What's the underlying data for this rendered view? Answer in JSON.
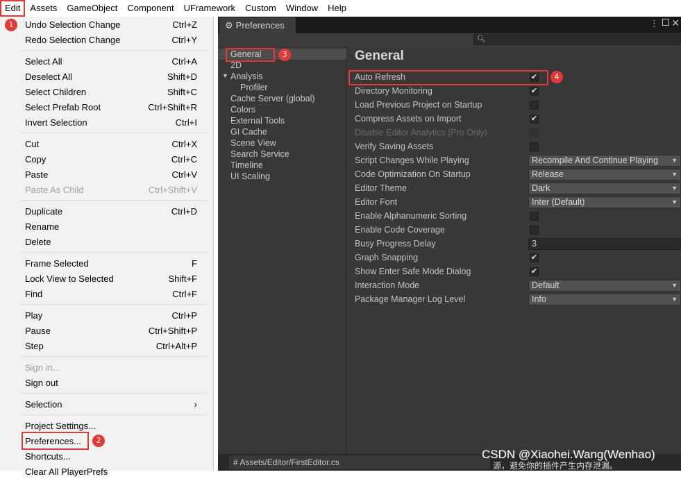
{
  "menubar": {
    "items": [
      "Edit",
      "Assets",
      "GameObject",
      "Component",
      "UFramework",
      "Custom",
      "Window",
      "Help"
    ],
    "active": "Edit"
  },
  "edit_menu": {
    "items": [
      {
        "label": "Undo Selection Change",
        "shortcut": "Ctrl+Z",
        "enabled": true
      },
      {
        "label": "Redo Selection Change",
        "shortcut": "Ctrl+Y",
        "enabled": true
      },
      {
        "label": "Select All",
        "shortcut": "Ctrl+A",
        "enabled": true
      },
      {
        "label": "Deselect All",
        "shortcut": "Shift+D",
        "enabled": true
      },
      {
        "label": "Select Children",
        "shortcut": "Shift+C",
        "enabled": true
      },
      {
        "label": "Select Prefab Root",
        "shortcut": "Ctrl+Shift+R",
        "enabled": true
      },
      {
        "label": "Invert Selection",
        "shortcut": "Ctrl+I",
        "enabled": true
      },
      {
        "label": "Cut",
        "shortcut": "Ctrl+X",
        "enabled": true
      },
      {
        "label": "Copy",
        "shortcut": "Ctrl+C",
        "enabled": true
      },
      {
        "label": "Paste",
        "shortcut": "Ctrl+V",
        "enabled": true
      },
      {
        "label": "Paste As Child",
        "shortcut": "Ctrl+Shift+V",
        "enabled": false
      },
      {
        "label": "Duplicate",
        "shortcut": "Ctrl+D",
        "enabled": true
      },
      {
        "label": "Rename",
        "shortcut": "",
        "enabled": true
      },
      {
        "label": "Delete",
        "shortcut": "",
        "enabled": true
      },
      {
        "label": "Frame Selected",
        "shortcut": "F",
        "enabled": true
      },
      {
        "label": "Lock View to Selected",
        "shortcut": "Shift+F",
        "enabled": true
      },
      {
        "label": "Find",
        "shortcut": "Ctrl+F",
        "enabled": true
      },
      {
        "label": "Play",
        "shortcut": "Ctrl+P",
        "enabled": true
      },
      {
        "label": "Pause",
        "shortcut": "Ctrl+Shift+P",
        "enabled": true
      },
      {
        "label": "Step",
        "shortcut": "Ctrl+Alt+P",
        "enabled": true
      },
      {
        "label": "Sign in...",
        "shortcut": "",
        "enabled": false
      },
      {
        "label": "Sign out",
        "shortcut": "",
        "enabled": true
      },
      {
        "label": "Selection",
        "shortcut": "›",
        "enabled": true
      },
      {
        "label": "Project Settings...",
        "shortcut": "",
        "enabled": true
      },
      {
        "label": "Preferences...",
        "shortcut": "",
        "enabled": true
      },
      {
        "label": "Shortcuts...",
        "shortcut": "",
        "enabled": true
      },
      {
        "label": "Clear All PlayerPrefs",
        "shortcut": "",
        "enabled": true
      }
    ]
  },
  "badges": [
    "1",
    "2",
    "3",
    "4"
  ],
  "preferences": {
    "tab_title": "Preferences",
    "tab_icon": "gear-icon",
    "search_icon": "search-icon",
    "categories": [
      "General",
      "2D",
      "Analysis",
      "Profiler",
      "Cache Server (global)",
      "Colors",
      "External Tools",
      "GI Cache",
      "Scene View",
      "Search Service",
      "Timeline",
      "UI Scaling"
    ],
    "selected_category": "General",
    "section_title": "General",
    "settings": [
      {
        "label": "Auto Refresh",
        "type": "checkbox",
        "checked": true
      },
      {
        "label": "Directory Monitoring",
        "type": "checkbox",
        "checked": true
      },
      {
        "label": "Load Previous Project on Startup",
        "type": "checkbox",
        "checked": false
      },
      {
        "label": "Compress Assets on Import",
        "type": "checkbox",
        "checked": true
      },
      {
        "label": "Disable Editor Analytics (Pro Only)",
        "type": "checkbox",
        "checked": false,
        "disabled": true
      },
      {
        "label": "Verify Saving Assets",
        "type": "checkbox",
        "checked": false
      },
      {
        "label": "Script Changes While Playing",
        "type": "dropdown",
        "value": "Recompile And Continue Playing"
      },
      {
        "label": "Code Optimization On Startup",
        "type": "dropdown",
        "value": "Release"
      },
      {
        "label": "Editor Theme",
        "type": "dropdown",
        "value": "Dark"
      },
      {
        "label": "Editor Font",
        "type": "dropdown",
        "value": "Inter (Default)"
      },
      {
        "label": "Enable Alphanumeric Sorting",
        "type": "checkbox",
        "checked": false
      },
      {
        "label": "Enable Code Coverage",
        "type": "checkbox",
        "checked": false
      },
      {
        "label": "Busy Progress Delay",
        "type": "number",
        "value": "3"
      },
      {
        "label": "Graph Snapping",
        "type": "checkbox",
        "checked": true
      },
      {
        "label": "Show Enter Safe Mode Dialog",
        "type": "checkbox",
        "checked": true
      },
      {
        "label": "Interaction Mode",
        "type": "dropdown",
        "value": "Default"
      },
      {
        "label": "Package Manager Log Level",
        "type": "dropdown",
        "value": "Info"
      }
    ]
  },
  "status": {
    "file": "Assets/Editor/FirstEditor.cs"
  },
  "watermark": {
    "main": "CSDN @Xiaohei.Wang(Wenhao)",
    "sub": "源，避免你的插件产生内存泄漏。"
  },
  "colors": {
    "highlight": "#e53935",
    "panel": "#383838",
    "dark": "#282828"
  }
}
